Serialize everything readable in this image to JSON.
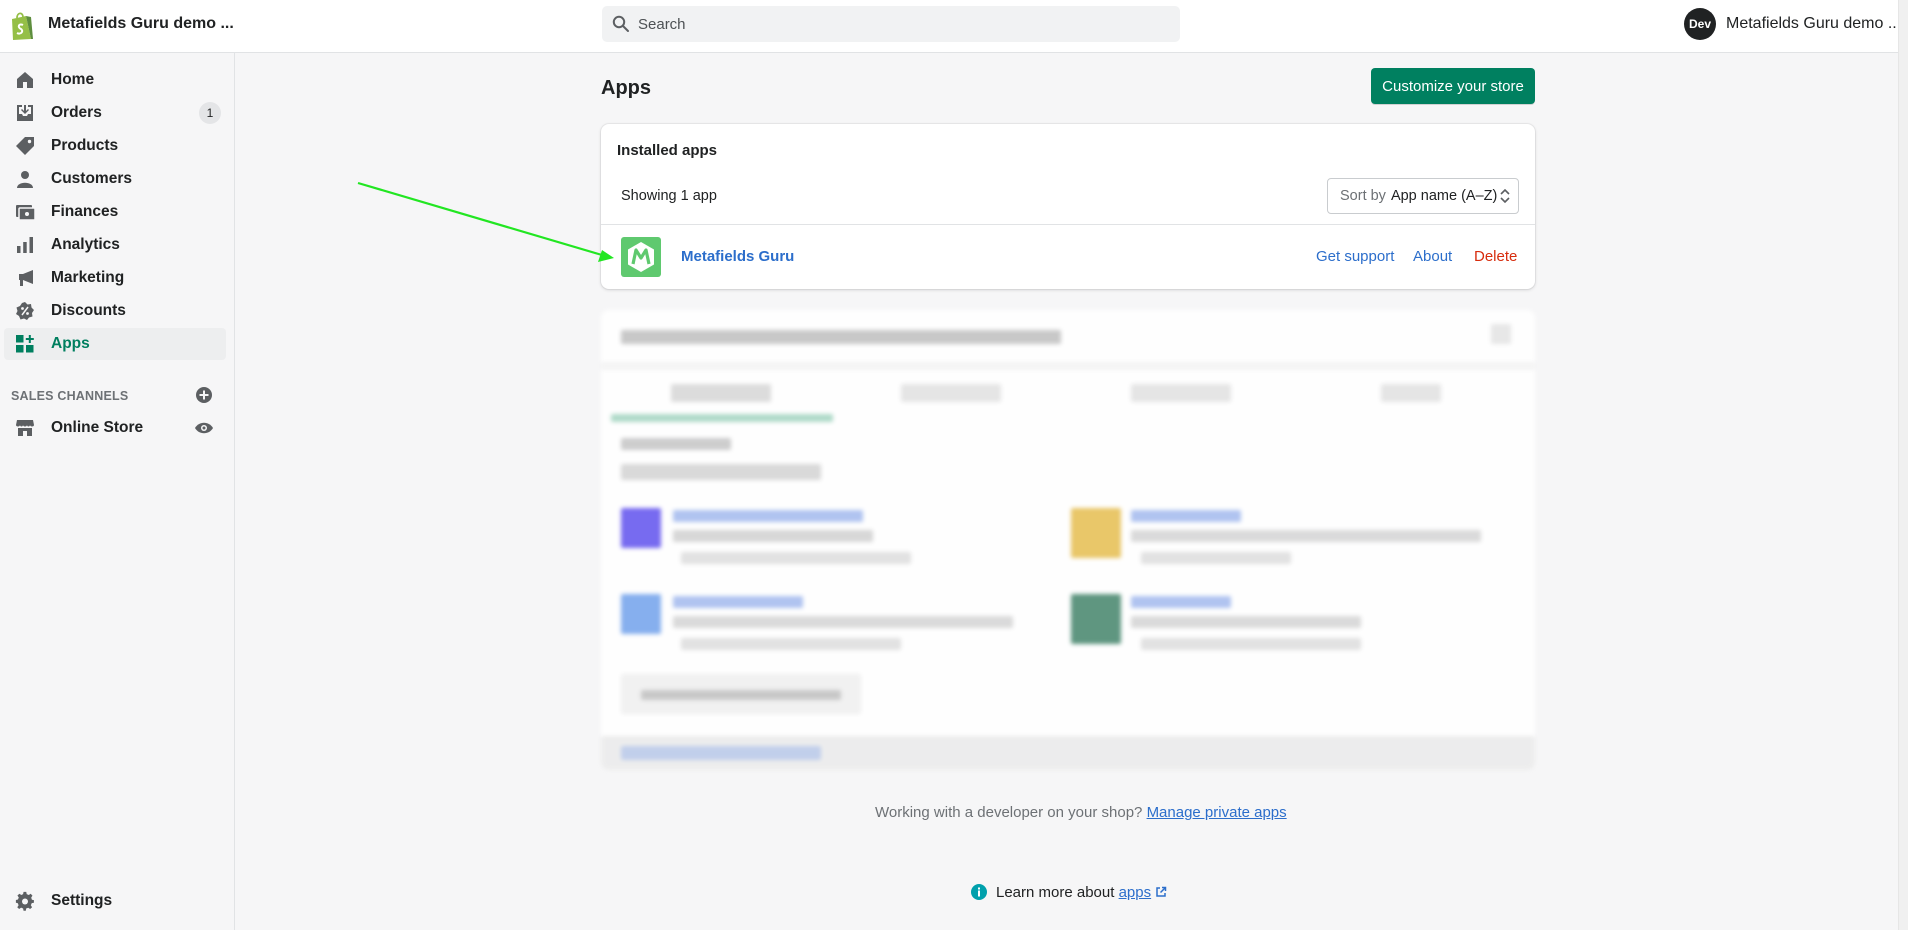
{
  "topbar": {
    "store_name": "Metafields Guru demo ...",
    "search_placeholder": "Search",
    "user_initials": "Dev",
    "user_name": "Metafields Guru demo ..."
  },
  "sidebar": {
    "items": [
      {
        "label": "Home",
        "icon": "home-icon"
      },
      {
        "label": "Orders",
        "icon": "orders-icon",
        "badge": "1"
      },
      {
        "label": "Products",
        "icon": "tag-icon"
      },
      {
        "label": "Customers",
        "icon": "person-icon"
      },
      {
        "label": "Finances",
        "icon": "finances-icon"
      },
      {
        "label": "Analytics",
        "icon": "bar-chart-icon"
      },
      {
        "label": "Marketing",
        "icon": "megaphone-icon"
      },
      {
        "label": "Discounts",
        "icon": "discount-icon"
      },
      {
        "label": "Apps",
        "icon": "apps-icon",
        "active": true
      }
    ],
    "sales_channels_title": "SALES CHANNELS",
    "online_store_label": "Online Store",
    "settings_label": "Settings"
  },
  "main": {
    "title": "Apps",
    "customize_button": "Customize your store",
    "installed_card": {
      "title": "Installed apps",
      "showing": "Showing 1 app",
      "sort_prefix": "Sort by",
      "sort_value": "App name (A–Z)",
      "app": {
        "name": "Metafields Guru",
        "actions": {
          "support": "Get support",
          "about": "About",
          "delete": "Delete"
        }
      }
    },
    "footer": {
      "developer_text": "Working with a developer on your shop?",
      "private_apps_link": "Manage private apps",
      "learn_text": "Learn more about",
      "apps_link": "apps"
    }
  },
  "colors": {
    "accent": "#008060",
    "active_nav_text": "#007f5f",
    "link": "#2c6ecb",
    "danger": "#d72c0d",
    "annotation_arrow": "#22e622"
  }
}
